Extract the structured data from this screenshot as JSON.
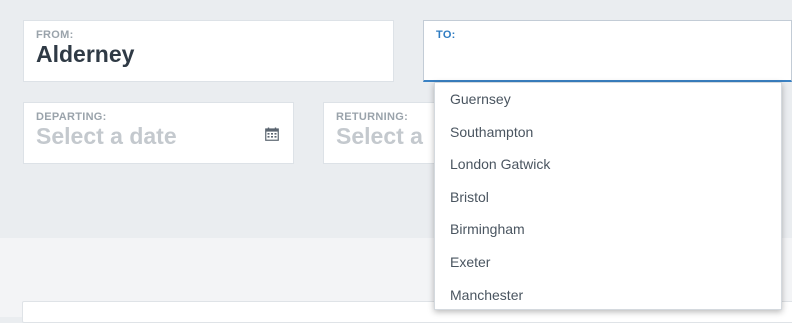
{
  "from": {
    "label": "FROM:",
    "value": "Alderney"
  },
  "to": {
    "label": "TO:",
    "value": ""
  },
  "departing": {
    "label": "DEPARTING:",
    "placeholder": "Select a date",
    "icon": "calendar-icon"
  },
  "returning": {
    "label": "RETURNING:",
    "placeholder": "Select a"
  },
  "destinations": [
    "Guernsey",
    "Southampton",
    "London Gatwick",
    "Bristol",
    "Birmingham",
    "Exeter",
    "Manchester"
  ],
  "colors": {
    "accent": "#2f7cc2",
    "background": "#eaedf0",
    "text": "#2f3a45",
    "placeholder": "#c4c9ce"
  }
}
